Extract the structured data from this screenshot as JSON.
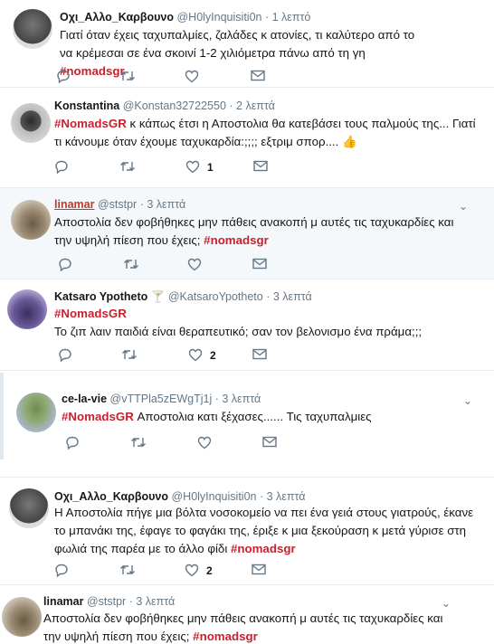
{
  "tweets": [
    {
      "name": "Οχι_Αλλο_Καρβουνο",
      "handle": "@H0lyInquisiti0n",
      "dot": "·",
      "time": "1 λεπτό",
      "text": "Γιατί όταν έχεις ταχυπαλμίες, ζαλάδες κ ατονίες, τι καλύτερο από το να κρέμεσαι σε ένα σκοινί 1-2 χιλιόμετρα πάνω από τη γη ",
      "tag_end": "#nomadsgr",
      "likes": ""
    },
    {
      "name": "Konstantina",
      "handle": "@Konstan32722550",
      "dot": "·",
      "time": "2 λεπτά",
      "tag_start": "#NomadsGR",
      "text": " κ κάπως έτσι η Αποστολια θα κατεβάσει τους παλμούς της... Γιατί τι κάνουμε όταν έχουμε ταχυκαρδία:;;;; εξτριμ σπορ.... ",
      "emoji": "👍",
      "likes": "1"
    },
    {
      "name": "linamar",
      "handle": "@ststpr",
      "dot": "·",
      "time": "3 λεπτά",
      "text": "Αποστολία δεν φοβήθηκες μην πάθεις ανακοπή μ αυτές τις ταχυκαρδίες και την υψηλή πίεση που έχεις; ",
      "tag_end": "#nomadsgr",
      "likes": ""
    },
    {
      "name": "Katsaro Ypotheto",
      "name_emoji": "🍸",
      "handle": "@KatsaroYpotheto",
      "dot": "·",
      "time": "3 λεπτά",
      "tag_line": "#NomadsGR",
      "text": "Το ζιπ λαιν παιδιά είναι θεραπευτικό; σαν τον βελονισμο ένα πράμα;;;",
      "likes": "2"
    },
    {
      "name": "ce-la-vie",
      "handle": "@vTTPla5zEWgTj1j",
      "dot": "·",
      "time": "3 λεπτά",
      "tag_start": "#NomadsGR",
      "text": " Αποστολια κατι ξέχασες...... Τις ταχυπαλμιες",
      "likes": ""
    },
    {
      "name": "Οχι_Αλλο_Καρβουνο",
      "handle": "@H0lyInquisiti0n",
      "dot": "·",
      "time": "3 λεπτά",
      "text": "Η Αποστολία πήγε μια βόλτα νοσοκομείο να πει ένα γειά στους γιατρούς, έκανε το μπανάκι της, έφαγε το φαγάκι της, έριξε κ μια ξεκούραση κ μετά γύρισε στη φωλιά της παρέα με το άλλο φίδι ",
      "tag_end": "#nomadsgr",
      "likes": "2"
    },
    {
      "name": "linamar",
      "handle": "@ststpr",
      "dot": "·",
      "time": "3 λεπτά",
      "text": "Αποστολία δεν φοβήθηκες μην πάθεις ανακοπή μ αυτές τις ταχυκαρδίες και την υψηλή πίεση που έχεις; ",
      "tag_end": "#nomadsgr",
      "likes": ""
    }
  ],
  "icons": {
    "reply": "reply-icon",
    "retweet": "retweet-icon",
    "like": "heart-icon",
    "dm": "mail-icon",
    "menu": "chevron-down-icon"
  },
  "colors": {
    "hashtag": "#c8202e",
    "muted": "#657786",
    "highlight_bg": "#f5f8fa"
  }
}
